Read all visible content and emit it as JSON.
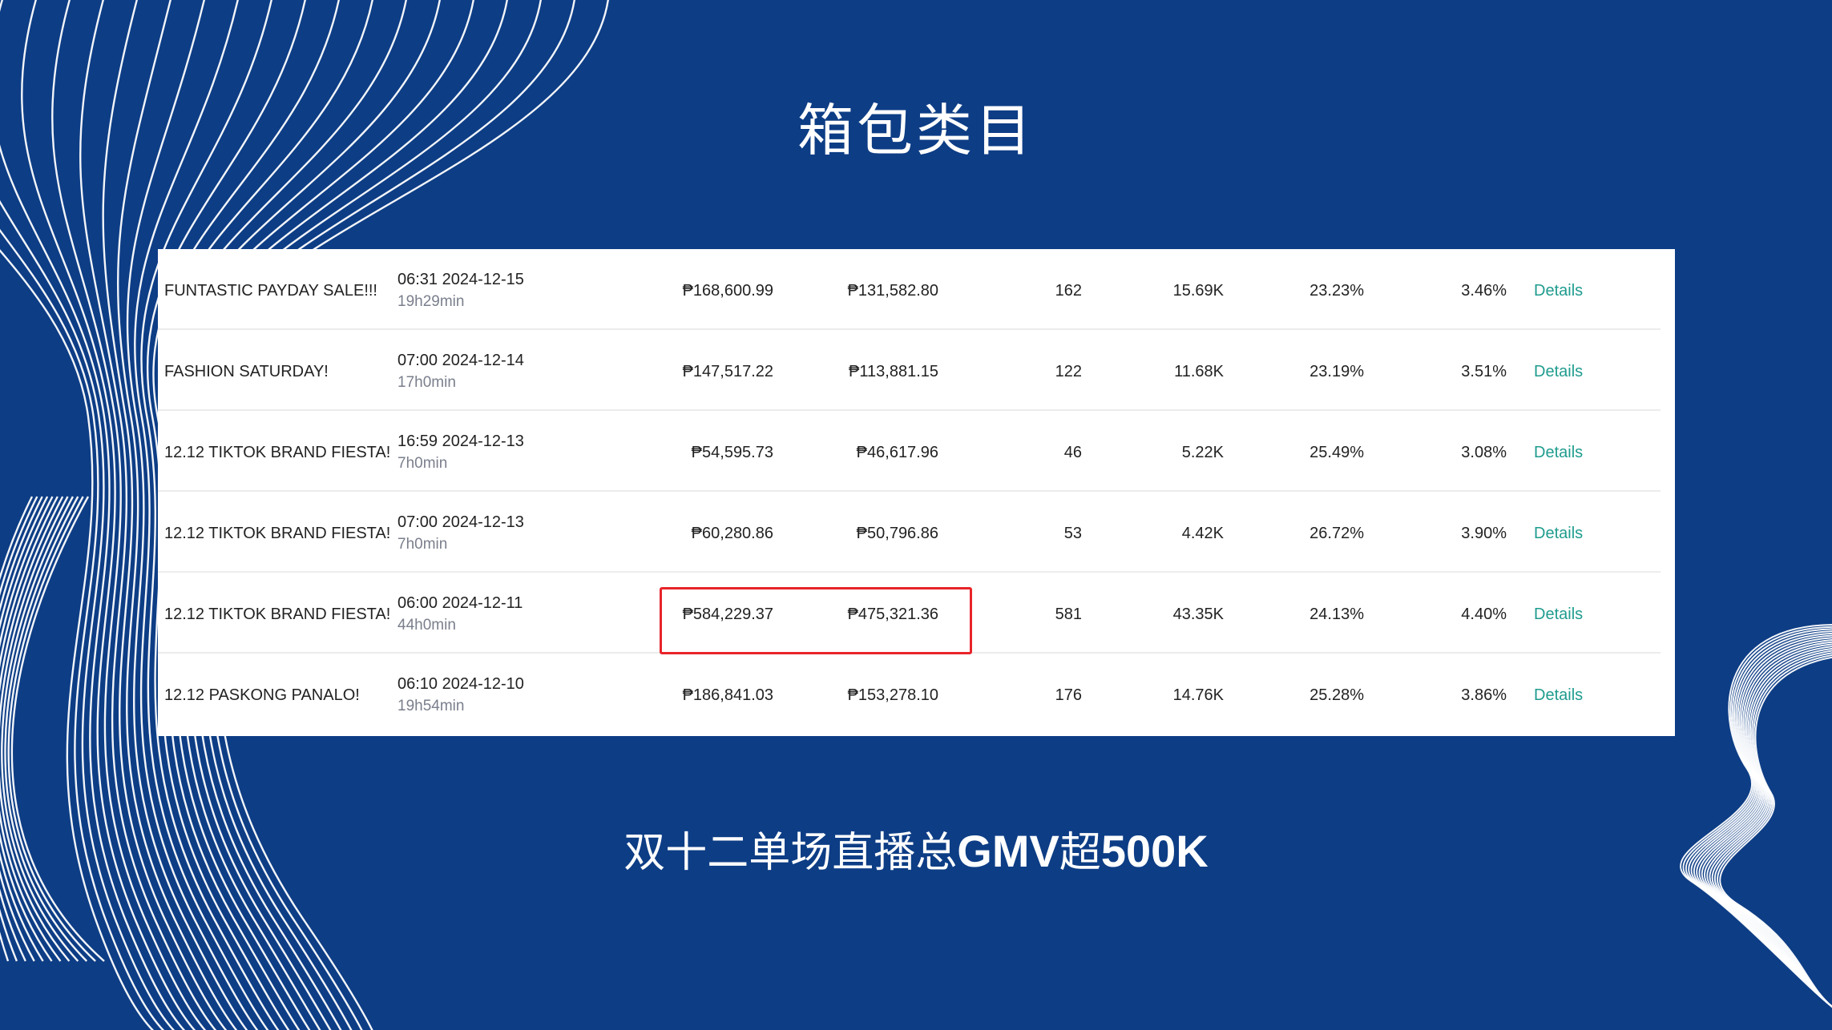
{
  "title": "箱包类目",
  "table": {
    "rows": [
      {
        "name": "FUNTASTIC PAYDAY SALE!!!",
        "start": "06:31 2024-12-15",
        "duration": "19h29min",
        "gmv": "₱168,600.99",
        "net": "₱131,582.80",
        "orders": "162",
        "views": "15.69K",
        "rate1": "23.23%",
        "rate2": "3.46%",
        "action": "Details"
      },
      {
        "name": "FASHION SATURDAY!",
        "start": "07:00 2024-12-14",
        "duration": "17h0min",
        "gmv": "₱147,517.22",
        "net": "₱113,881.15",
        "orders": "122",
        "views": "11.68K",
        "rate1": "23.19%",
        "rate2": "3.51%",
        "action": "Details"
      },
      {
        "name": "12.12 TIKTOK BRAND FIESTA!",
        "start": "16:59 2024-12-13",
        "duration": "7h0min",
        "gmv": "₱54,595.73",
        "net": "₱46,617.96",
        "orders": "46",
        "views": "5.22K",
        "rate1": "25.49%",
        "rate2": "3.08%",
        "action": "Details"
      },
      {
        "name": "12.12 TIKTOK BRAND FIESTA!",
        "start": "07:00 2024-12-13",
        "duration": "7h0min",
        "gmv": "₱60,280.86",
        "net": "₱50,796.86",
        "orders": "53",
        "views": "4.42K",
        "rate1": "26.72%",
        "rate2": "3.90%",
        "action": "Details"
      },
      {
        "name": "12.12 TIKTOK BRAND FIESTA!",
        "start": "06:00 2024-12-11",
        "duration": "44h0min",
        "gmv": "₱584,229.37",
        "net": "₱475,321.36",
        "orders": "581",
        "views": "43.35K",
        "rate1": "24.13%",
        "rate2": "4.40%",
        "action": "Details"
      },
      {
        "name": "12.12 PASKONG PANALO!",
        "start": "06:10 2024-12-10",
        "duration": "19h54min",
        "gmv": "₱186,841.03",
        "net": "₱153,278.10",
        "orders": "176",
        "views": "14.76K",
        "rate1": "25.28%",
        "rate2": "3.86%",
        "action": "Details"
      }
    ]
  },
  "subtitle": {
    "part1": "双十二单场直播总",
    "part2": "GMV",
    "part3": "超",
    "part4": "500K"
  },
  "colors": {
    "background": "#0d3d85",
    "highlight": "#e8242a",
    "link": "#1f9c8e"
  }
}
